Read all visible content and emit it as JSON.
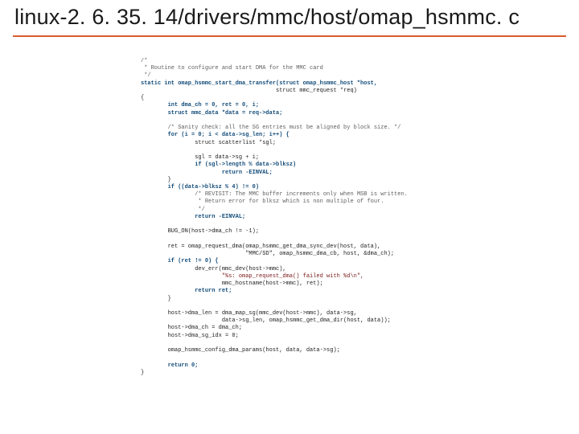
{
  "title": "linux-2. 6. 35. 14/drivers/mmc/host/omap_hsmmc. c",
  "code": [
    "/*",
    " * Routine to configure and start DMA for the MMC card",
    " */",
    "static int omap_hsmmc_start_dma_transfer(struct omap_hsmmc_host *host,",
    "                                        struct mmc_request *req)",
    "{",
    "        int dma_ch = 0, ret = 0, i;",
    "        struct mmc_data *data = req->data;",
    "",
    "        /* Sanity check: all the SG entries must be aligned by block size. */",
    "        for (i = 0; i < data->sg_len; i++) {",
    "                struct scatterlist *sgl;",
    "",
    "                sgl = data->sg + i;",
    "                if (sgl->length % data->blksz)",
    "                        return -EINVAL;",
    "        }",
    "        if ((data->blksz % 4) != 0)",
    "                /* REVISIT: The MMC buffer increments only when MSB is written.",
    "                 * Return error for blksz which is non multiple of four.",
    "                 */",
    "                return -EINVAL;",
    "",
    "        BUG_ON(host->dma_ch != -1);",
    "",
    "        ret = omap_request_dma(omap_hsmmc_get_dma_sync_dev(host, data),",
    "                               \"MMC/SD\", omap_hsmmc_dma_cb, host, &dma_ch);",
    "        if (ret != 0) {",
    "                dev_err(mmc_dev(host->mmc),",
    "                        \"%s: omap_request_dma() failed with %d\\n\",",
    "                        mmc_hostname(host->mmc), ret);",
    "                return ret;",
    "        }",
    "",
    "        host->dma_len = dma_map_sg(mmc_dev(host->mmc), data->sg,",
    "                        data->sg_len, omap_hsmmc_get_dma_dir(host, data));",
    "        host->dma_ch = dma_ch;",
    "        host->dma_sg_idx = 0;",
    "",
    "        omap_hsmmc_config_dma_params(host, data, data->sg);",
    "",
    "        return 0;",
    "}"
  ]
}
